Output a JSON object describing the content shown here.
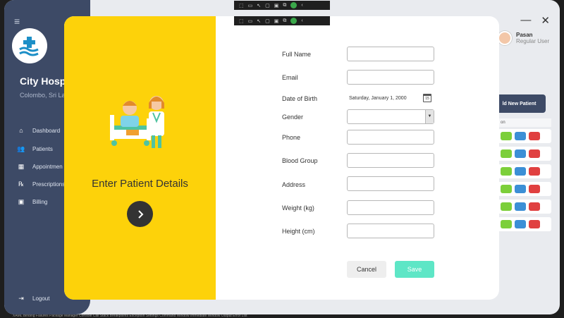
{
  "app": {
    "hospital_name": "City Hospi",
    "hospital_location": "Colombo, Sri La",
    "nav": [
      {
        "icon": "home-icon",
        "label": "Dashboard"
      },
      {
        "icon": "patients-icon",
        "label": "Patients"
      },
      {
        "icon": "calendar-icon",
        "label": "Appointmen"
      },
      {
        "icon": "prescription-icon",
        "label": "Prescriptions"
      },
      {
        "icon": "billing-icon",
        "label": "Billing"
      }
    ],
    "logout_label": "Logout",
    "user_name": "Pasan",
    "user_role": "Regular User",
    "add_patient_label": "ld New Patient",
    "table_header": "on"
  },
  "modal": {
    "panel_title": "Enter Patient Details",
    "fields": {
      "full_name": {
        "label": "Full Name",
        "value": ""
      },
      "email": {
        "label": "Email",
        "value": ""
      },
      "dob": {
        "label": "Date of Birth",
        "value": "Saturday, January 1, 2000",
        "calendar_day": "15"
      },
      "gender": {
        "label": "Gender",
        "value": ""
      },
      "phone": {
        "label": "Phone",
        "value": ""
      },
      "blood_group": {
        "label": "Blood Group",
        "value": ""
      },
      "address": {
        "label": "Address",
        "value": ""
      },
      "weight": {
        "label": "Weight (kg)",
        "value": ""
      },
      "height": {
        "label": "Height (cm)",
        "value": ""
      }
    },
    "cancel_label": "Cancel",
    "save_label": "Save"
  },
  "colors": {
    "sidebar": "#3d4a66",
    "panel_yellow": "#fdd20a",
    "save_accent": "#5ee6c6"
  },
  "statusbar_text": "XAML Binding Failures   Package Manager Console   Call Stack   Breakpoints   Exception Settings   Command Window   Immediate Window   Output   Error List"
}
